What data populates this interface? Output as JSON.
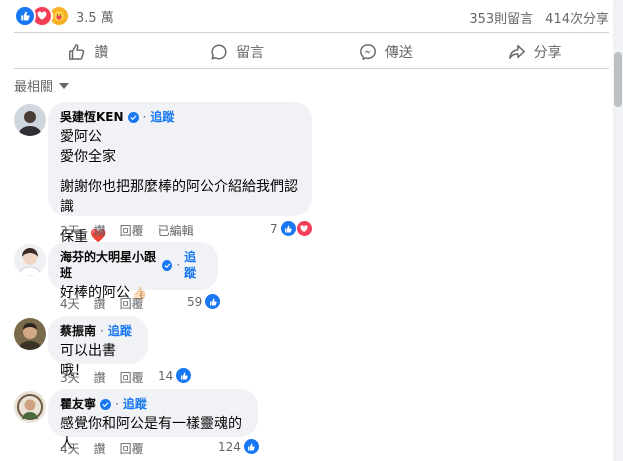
{
  "summary": {
    "reaction_total": "3.5 萬",
    "comments_count": "353則留言",
    "shares_count": "414次分享"
  },
  "actions": {
    "like": "讚",
    "comment": "留言",
    "send": "傳送",
    "share": "分享"
  },
  "sort_label": "最相關",
  "comments": [
    {
      "author": "吳建恆KEN",
      "follow": "追蹤",
      "lines": [
        "愛阿公",
        "愛你全家",
        "謝謝你也把那麼棒的阿公介紹給我們認識",
        "保重"
      ],
      "emoji": "❤️",
      "time": "3天",
      "like_label": "讚",
      "reply_label": "回覆",
      "edited_label": "已編輯",
      "reactions": "7"
    },
    {
      "author": "海芬的大明星小跟班",
      "follow": "追蹤",
      "lines": [
        "好棒的阿公"
      ],
      "emoji": "👍🏻",
      "time": "4天",
      "like_label": "讚",
      "reply_label": "回覆",
      "reactions": "59"
    },
    {
      "author": "蔡振南",
      "follow": "追蹤",
      "lines": [
        "可以出書哦！"
      ],
      "time": "3天",
      "like_label": "讚",
      "reply_label": "回覆",
      "reactions": "14"
    },
    {
      "author": "瞿友寧",
      "follow": "追蹤",
      "lines": [
        "感覺你和阿公是有一樣靈魂的人"
      ],
      "time": "4天",
      "like_label": "讚",
      "reply_label": "回覆",
      "reactions": "124"
    }
  ],
  "colors": {
    "accent": "#1877f2",
    "love": "#f33e58",
    "care": "#f7b125",
    "bubble": "#f0f2f5",
    "meta": "#65676b"
  }
}
